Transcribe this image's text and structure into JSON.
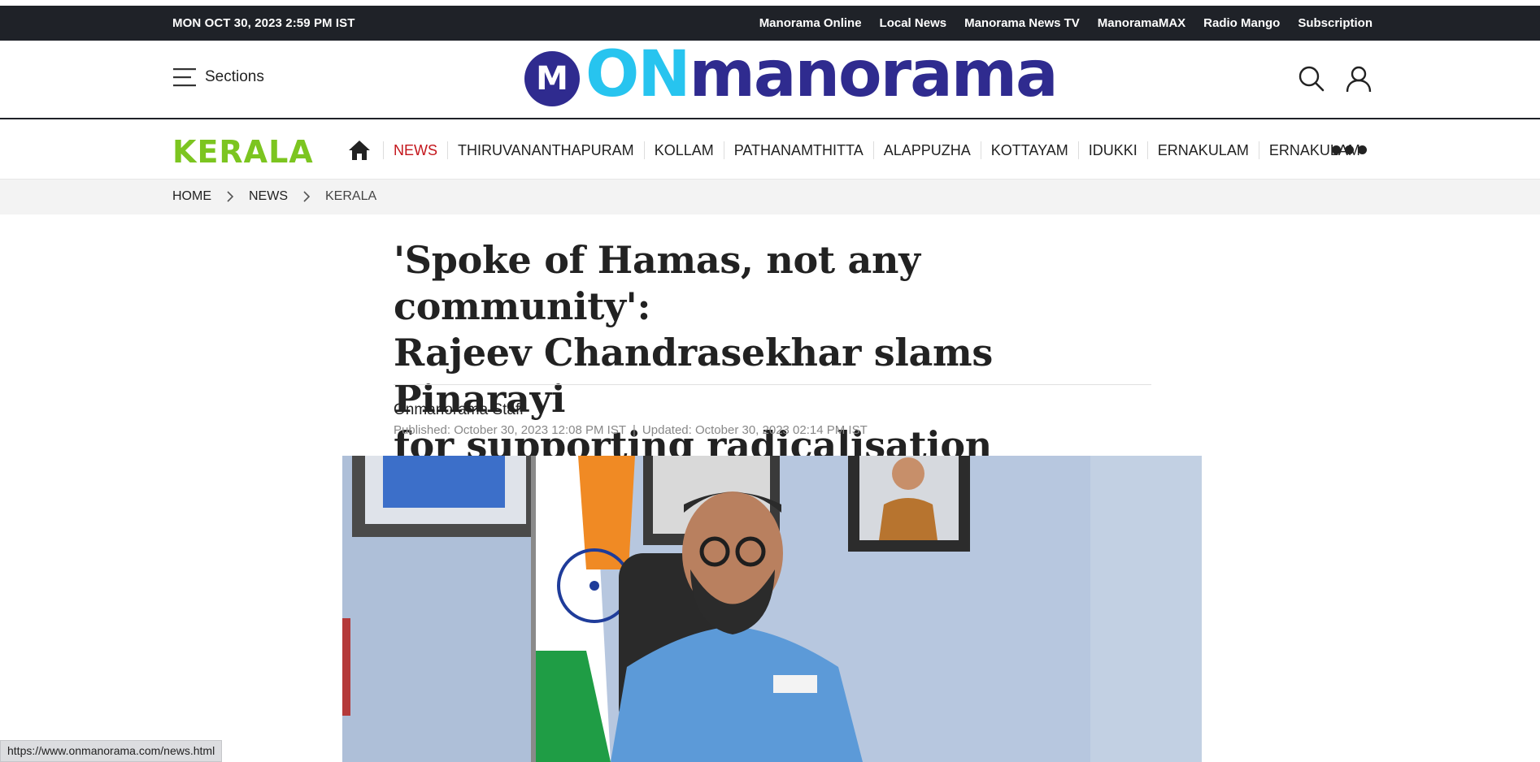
{
  "topbar": {
    "date": "MON OCT 30, 2023 2:59 PM IST",
    "links": [
      "Manorama Online",
      "Local News",
      "Manorama News TV",
      "ManoramaMAX",
      "Radio Mango",
      "Subscription"
    ]
  },
  "header": {
    "sections_label": "Sections",
    "logo_on": "ON",
    "logo_manorama": "manorama",
    "logo_mark": "M"
  },
  "section_nav": {
    "title": "KERALA",
    "items": [
      {
        "label": "NEWS",
        "active": true
      },
      {
        "label": "THIRUVANANTHAPURAM",
        "active": false
      },
      {
        "label": "KOLLAM",
        "active": false
      },
      {
        "label": "PATHANAMTHITTA",
        "active": false
      },
      {
        "label": "ALAPPUZHA",
        "active": false
      },
      {
        "label": "KOTTAYAM",
        "active": false
      },
      {
        "label": "IDUKKI",
        "active": false
      },
      {
        "label": "ERNAKULAM",
        "active": false
      },
      {
        "label": "ERNAKULAM",
        "active": false
      }
    ]
  },
  "breadcrumb": {
    "items": [
      "HOME",
      "NEWS",
      "KERALA"
    ]
  },
  "article": {
    "headline_lines": [
      "'Spoke of Hamas, not any community':",
      "Rajeev Chandrasekhar slams Pinarayi",
      "for supporting radicalisation"
    ],
    "author": "Onmanorama Staff",
    "published": "Published: October 30, 2023 12:08 PM IST",
    "updated": "Updated: October 30, 2023 02:14 PM IST"
  },
  "status_bar": {
    "url": "https://www.onmanorama.com/news.html"
  },
  "colors": {
    "topbar_bg": "#1f2228",
    "logo_blue": "#2f2b8f",
    "logo_cyan": "#27c4ef",
    "kerala_green": "#7cc520",
    "active_red": "#c4161c"
  },
  "icons": [
    "hamburger-icon",
    "search-icon",
    "user-icon",
    "home-icon",
    "more-dots-icon",
    "chevron-right-icon"
  ]
}
